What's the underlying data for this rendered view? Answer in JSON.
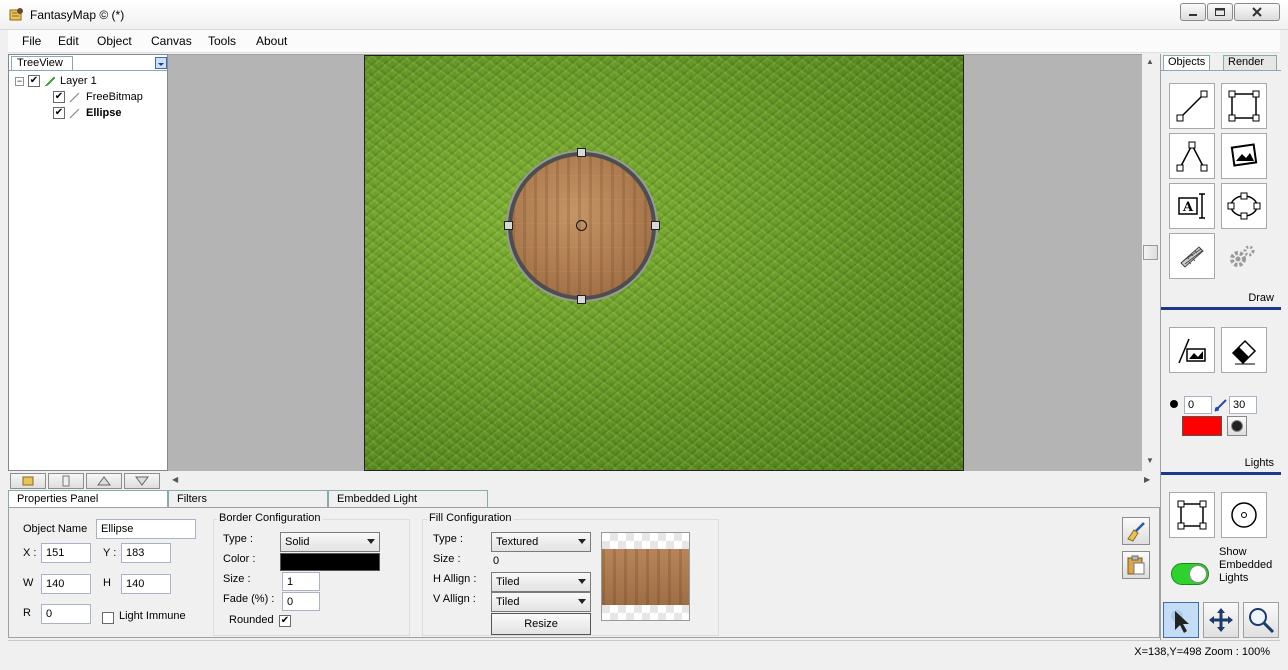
{
  "window": {
    "title": "FantasyMap © (*)"
  },
  "menu": [
    "File",
    "Edit",
    "Object",
    "Canvas",
    "Tools",
    "About"
  ],
  "tree": {
    "tab_label": "TreeView",
    "items": [
      {
        "label": "Layer 1",
        "checked": true,
        "level": 0
      },
      {
        "label": "FreeBitmap",
        "checked": true,
        "level": 1
      },
      {
        "label": "Ellipse",
        "checked": true,
        "level": 1,
        "selected": true
      }
    ]
  },
  "right_panel": {
    "tabs": [
      "Objects",
      "Render"
    ],
    "draw_label": "Draw",
    "lights_label": "Lights",
    "light_size_a": "0",
    "light_size_b": "30",
    "light_color": "#ff0000",
    "show_embedded_lights_label": "Show Embedded Lights",
    "show_embedded_lights_on": true
  },
  "bottom_tabs": [
    "Properties Panel",
    "Filters",
    "Embedded Light"
  ],
  "properties": {
    "object_name_label": "Object Name",
    "object_name": "Ellipse",
    "x_label": "X :",
    "x": "151",
    "y_label": "Y :",
    "y": "183",
    "w_label": "W",
    "w": "140",
    "h_label": "H",
    "h": "140",
    "r_label": "R",
    "r": "0",
    "light_immune_label": "Light Immune",
    "light_immune": false
  },
  "border": {
    "title": "Border Configuration",
    "type_label": "Type :",
    "type": "Solid",
    "color_label": "Color :",
    "color": "#000000",
    "size_label": "Size :",
    "size": "1",
    "fade_label": "Fade (%) :",
    "fade": "0",
    "rounded_label": "Rounded",
    "rounded": true
  },
  "fill": {
    "title": "Fill Configuration",
    "type_label": "Type :",
    "type": "Textured",
    "size_label": "Size :",
    "size": "0",
    "halign_label": "H Allign :",
    "halign": "Tiled",
    "valign_label": "V Allign :",
    "valign": "Tiled",
    "resize_label": "Resize"
  },
  "status": {
    "text": "X=138,Y=498  Zoom : 100%"
  },
  "colors": {
    "selection_handle": "#d8d8d8",
    "accent_separator": "#1c3a8c"
  }
}
